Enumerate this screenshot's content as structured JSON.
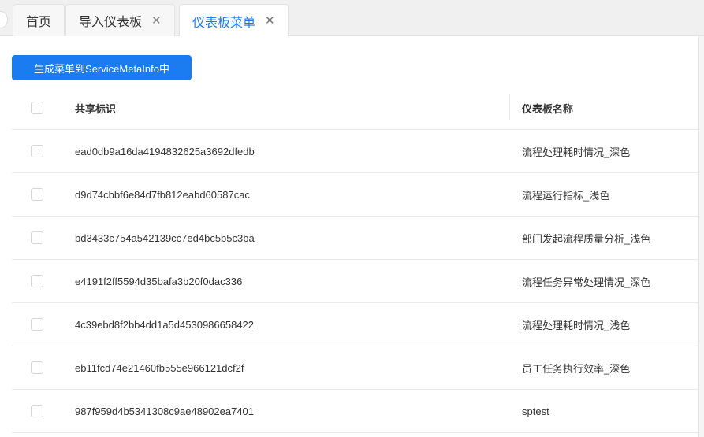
{
  "tabs": [
    {
      "label": "首页",
      "closable": false,
      "active": false
    },
    {
      "label": "导入仪表板",
      "closable": true,
      "active": false
    },
    {
      "label": "仪表板菜单",
      "closable": true,
      "active": true
    }
  ],
  "close_glyph": "✕",
  "toolbar": {
    "generate_label": "生成菜单到ServiceMetaInfo中"
  },
  "table": {
    "headers": {
      "share_id": "共享标识",
      "dashboard_name": "仪表板名称"
    },
    "rows": [
      {
        "share_id": "ead0db9a16da4194832625a3692dfedb",
        "dashboard_name": "流程处理耗时情况_深色"
      },
      {
        "share_id": "d9d74cbbf6e84d7fb812eabd60587cac",
        "dashboard_name": "流程运行指标_浅色"
      },
      {
        "share_id": "bd3433c754a542139cc7ed4bc5b5c3ba",
        "dashboard_name": "部门发起流程质量分析_浅色"
      },
      {
        "share_id": "e4191f2ff5594d35bafa3b20f0dac336",
        "dashboard_name": "流程任务异常处理情况_深色"
      },
      {
        "share_id": "4c39ebd8f2bb4dd1a5d4530986658422",
        "dashboard_name": "流程处理耗时情况_浅色"
      },
      {
        "share_id": "eb11fcd74e21460fb555e966121dcf2f",
        "dashboard_name": "员工任务执行效率_深色"
      },
      {
        "share_id": "987f959d4b5341308c9ae48902ea7401",
        "dashboard_name": "sptest"
      }
    ]
  },
  "colors": {
    "primary": "#1a7cf0",
    "active_tab_text": "#1f7ae8"
  }
}
